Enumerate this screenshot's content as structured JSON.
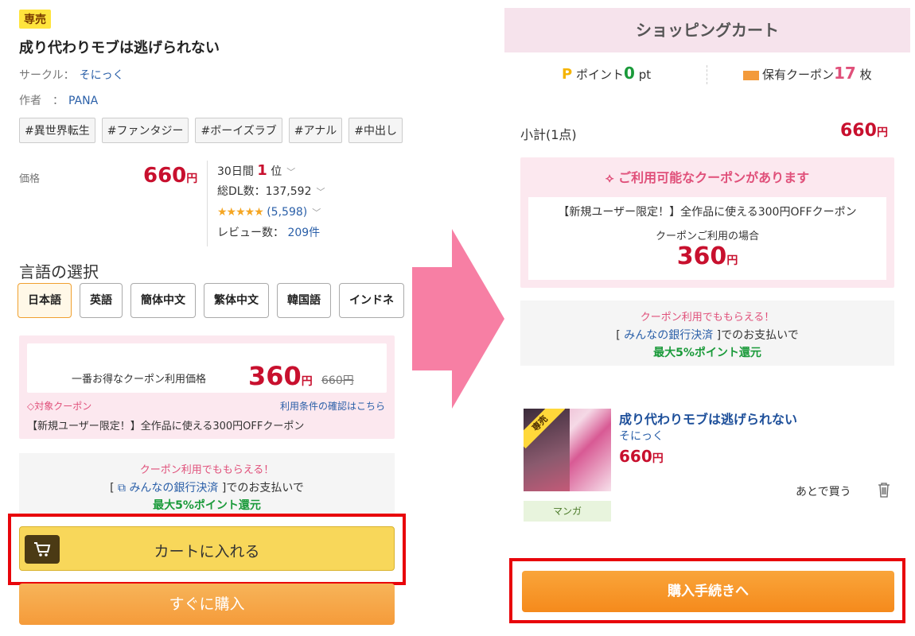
{
  "left": {
    "badge": "専売",
    "title": "成り代わりモブは逃げられない",
    "circle_label": "サークル：",
    "circle_value": "そにっく",
    "author_label": "作者　：",
    "author_value": "PANA",
    "tags": [
      "#異世界転生",
      "#ファンタジー",
      "#ボーイズラブ",
      "#アナル",
      "#中出し"
    ],
    "price_label": "価格",
    "price_value": "660",
    "yen": "円",
    "stats": {
      "rank_prefix": "30日間",
      "rank_value": "1",
      "rank_suffix": "位",
      "downloads": "総DL数：137,592",
      "stars": "★★★★★",
      "rating_count": "(5,598)",
      "review_label": "レビュー数：",
      "review_count": "209件"
    },
    "language_title": "言語の選択",
    "languages": [
      "日本語",
      "英語",
      "簡体中文",
      "繁体中文",
      "韓国語",
      "インドネ"
    ],
    "coupon": {
      "best_label": "一番お得なクーポン利用価格",
      "coupon_price": "360",
      "original_price": "660円",
      "target_label": "対象クーポン",
      "terms_link": "利用条件の確認はこちら",
      "description": "【新規ユーザー限定！】全作品に使える300円OFFクーポン"
    },
    "bank": {
      "header": "クーポン利用でももらえる！",
      "line_prefix": "[",
      "line_link": "みんなの銀行決済",
      "line_suffix": "]でのお支払いで",
      "reward": "最大5%ポイント還元"
    },
    "cart_button": "カートに入れる",
    "buy_button": "すぐに購入"
  },
  "right": {
    "header": "ショッピングカート",
    "points_label": "ポイント",
    "points_value": "0",
    "points_unit": "pt",
    "coupon_label": "保有クーポン",
    "coupon_value": "17",
    "coupon_unit": "枚",
    "subtotal_label": "小計(1点)",
    "subtotal_value": "660",
    "coupon_box": {
      "header": "ご利用可能なクーポンがあります",
      "description": "【新規ユーザー限定！】全作品に使える300円OFFクーポン",
      "case_label": "クーポンご利用の場合",
      "price": "360"
    },
    "bank": {
      "header": "クーポン利用でももらえる！",
      "line_prefix": "[ ",
      "line_link": "みんなの銀行決済",
      "line_suffix": " ]でのお支払いで",
      "reward": "最大5%ポイント還元"
    },
    "product": {
      "badge": "専売",
      "title": "成り代わりモブは逃げられない",
      "circle": "そにっく",
      "price": "660",
      "category": "マンガ",
      "later": "あとで買う"
    },
    "proceed_button": "購入手続きへ"
  },
  "colors": {
    "price_red": "#c8102e",
    "coupon_pink": "#fce8ef",
    "cart_yellow": "#f8d75a",
    "buy_orange": "#f59b3a",
    "highlight_red": "#e8050b",
    "arrow_pink": "#f77fa4"
  }
}
